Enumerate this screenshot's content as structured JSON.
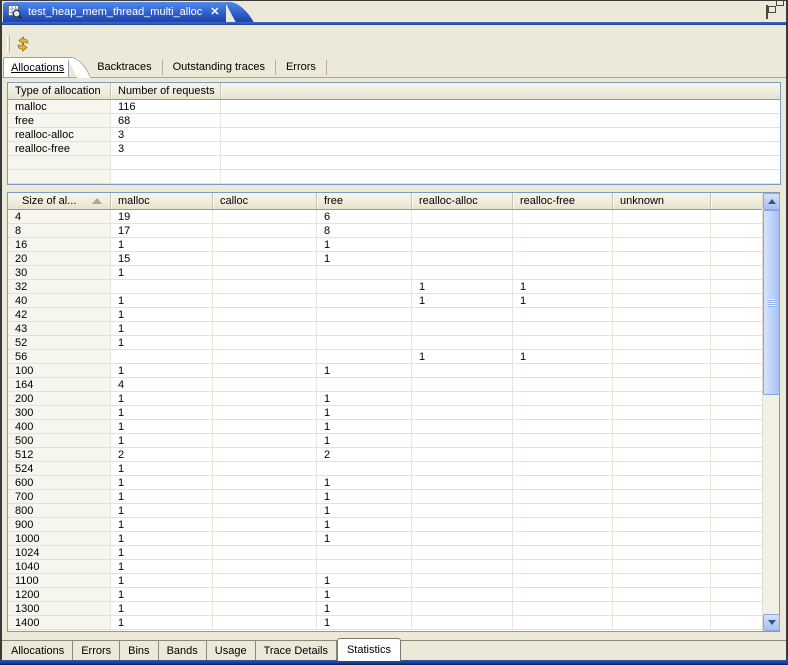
{
  "window": {
    "title": "test_heap_mem_thread_multi_alloc"
  },
  "icons": {
    "view_icon": "memory-analysis-icon",
    "close_icon": "close-icon",
    "minimize_icon": "minimize-icon",
    "restore_icon": "restore-icon",
    "toolbar_icon": "refresh-arrows-icon",
    "sort_icon": "sort-ascending-icon"
  },
  "colors": {
    "window_bg": "#ECE9D8",
    "tab_blue_top": "#5189E8",
    "tab_blue_bottom": "#1F41A5",
    "table_border": "#7F9DB9",
    "gold_icon": "#E8B840",
    "bottom_bar_blue": "#16337F"
  },
  "top_tabs": {
    "selected": "Allocations",
    "items": [
      {
        "label": "Allocations",
        "selected": true
      },
      {
        "label": "Backtraces",
        "selected": false
      },
      {
        "label": "Outstanding traces",
        "selected": false
      },
      {
        "label": "Errors",
        "selected": false
      }
    ]
  },
  "summary_table": {
    "columns": [
      "Type of allocation",
      "Number of requests"
    ],
    "rows": [
      [
        "malloc",
        "116"
      ],
      [
        "free",
        "68"
      ],
      [
        "realloc-alloc",
        "3"
      ],
      [
        "realloc-free",
        "3"
      ]
    ]
  },
  "size_table": {
    "columns": [
      "Size of al...",
      "malloc",
      "calloc",
      "free",
      "realloc-alloc",
      "realloc-free",
      "unknown"
    ],
    "sort_column": "Size of al...",
    "sort_direction": "ascending",
    "rows": [
      [
        "4",
        "19",
        "",
        "6",
        "",
        "",
        ""
      ],
      [
        "8",
        "17",
        "",
        "8",
        "",
        "",
        ""
      ],
      [
        "16",
        "1",
        "",
        "1",
        "",
        "",
        ""
      ],
      [
        "20",
        "15",
        "",
        "1",
        "",
        "",
        ""
      ],
      [
        "30",
        "1",
        "",
        "",
        "",
        "",
        ""
      ],
      [
        "32",
        "",
        "",
        "",
        "1",
        "1",
        ""
      ],
      [
        "40",
        "1",
        "",
        "",
        "1",
        "1",
        ""
      ],
      [
        "42",
        "1",
        "",
        "",
        "",
        "",
        ""
      ],
      [
        "43",
        "1",
        "",
        "",
        "",
        "",
        ""
      ],
      [
        "52",
        "1",
        "",
        "",
        "",
        "",
        ""
      ],
      [
        "56",
        "",
        "",
        "",
        "1",
        "1",
        ""
      ],
      [
        "100",
        "1",
        "",
        "1",
        "",
        "",
        ""
      ],
      [
        "164",
        "4",
        "",
        "",
        "",
        "",
        ""
      ],
      [
        "200",
        "1",
        "",
        "1",
        "",
        "",
        ""
      ],
      [
        "300",
        "1",
        "",
        "1",
        "",
        "",
        ""
      ],
      [
        "400",
        "1",
        "",
        "1",
        "",
        "",
        ""
      ],
      [
        "500",
        "1",
        "",
        "1",
        "",
        "",
        ""
      ],
      [
        "512",
        "2",
        "",
        "2",
        "",
        "",
        ""
      ],
      [
        "524",
        "1",
        "",
        "",
        "",
        "",
        ""
      ],
      [
        "600",
        "1",
        "",
        "1",
        "",
        "",
        ""
      ],
      [
        "700",
        "1",
        "",
        "1",
        "",
        "",
        ""
      ],
      [
        "800",
        "1",
        "",
        "1",
        "",
        "",
        ""
      ],
      [
        "900",
        "1",
        "",
        "1",
        "",
        "",
        ""
      ],
      [
        "1000",
        "1",
        "",
        "1",
        "",
        "",
        ""
      ],
      [
        "1024",
        "1",
        "",
        "",
        "",
        "",
        ""
      ],
      [
        "1040",
        "1",
        "",
        "",
        "",
        "",
        ""
      ],
      [
        "1100",
        "1",
        "",
        "1",
        "",
        "",
        ""
      ],
      [
        "1200",
        "1",
        "",
        "1",
        "",
        "",
        ""
      ],
      [
        "1300",
        "1",
        "",
        "1",
        "",
        "",
        ""
      ],
      [
        "1400",
        "1",
        "",
        "1",
        "",
        "",
        ""
      ]
    ]
  },
  "bottom_tabs": {
    "selected": "Statistics",
    "items": [
      {
        "label": "Allocations",
        "selected": false
      },
      {
        "label": "Errors",
        "selected": false
      },
      {
        "label": "Bins",
        "selected": false
      },
      {
        "label": "Bands",
        "selected": false
      },
      {
        "label": "Usage",
        "selected": false
      },
      {
        "label": "Trace Details",
        "selected": false
      },
      {
        "label": "Statistics",
        "selected": true
      }
    ]
  }
}
